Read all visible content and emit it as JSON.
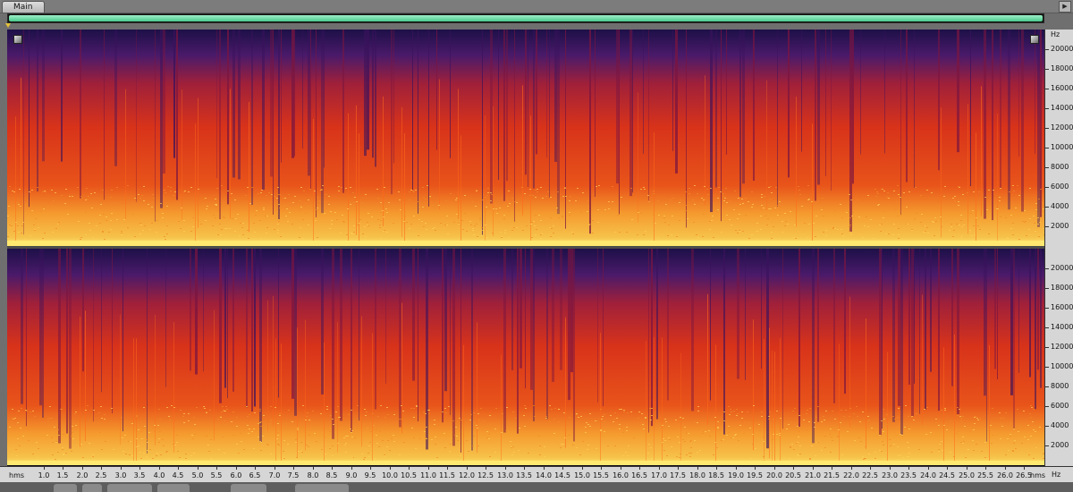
{
  "tabs": [
    {
      "label": "Main"
    }
  ],
  "tab_scroll_glyph": "▶",
  "colors": {
    "overview_fill": "#49c98c",
    "playhead": "#e6c13a",
    "spectro_low": "#1a0f3c",
    "spectro_mid": "#d62a12",
    "spectro_high": "#ffd64a"
  },
  "frequency_ruler": {
    "unit": "Hz",
    "channel_labels": [
      "20000",
      "18000",
      "16000",
      "14000",
      "12000",
      "10000",
      "8000",
      "6000",
      "4000",
      "2000"
    ],
    "bottom_unit": "Hz"
  },
  "time_ruler": {
    "unit_left": "hms",
    "unit_right": "hms",
    "labels": [
      "1.0",
      "1.5",
      "2.0",
      "2.5",
      "3.0",
      "3.5",
      "4.0",
      "4.5",
      "5.0",
      "5.5",
      "6.0",
      "6.5",
      "7.0",
      "7.5",
      "8.0",
      "8.5",
      "9.0",
      "9.5",
      "10.0",
      "10.5",
      "11.0",
      "11.5",
      "12.0",
      "12.5",
      "13.0",
      "13.5",
      "14.0",
      "14.5",
      "15.0",
      "15.5",
      "16.0",
      "16.5",
      "17.0",
      "17.5",
      "18.0",
      "18.5",
      "19.0",
      "19.5",
      "20.0",
      "20.5",
      "21.0",
      "21.5",
      "22.0",
      "22.5",
      "23.0",
      "23.5",
      "24.0",
      "24.5",
      "25.0",
      "25.5",
      "26.0",
      "26.5"
    ]
  },
  "icons": {
    "corner_left": "zoom-corner-icon",
    "corner_right": "zoom-corner-icon"
  }
}
